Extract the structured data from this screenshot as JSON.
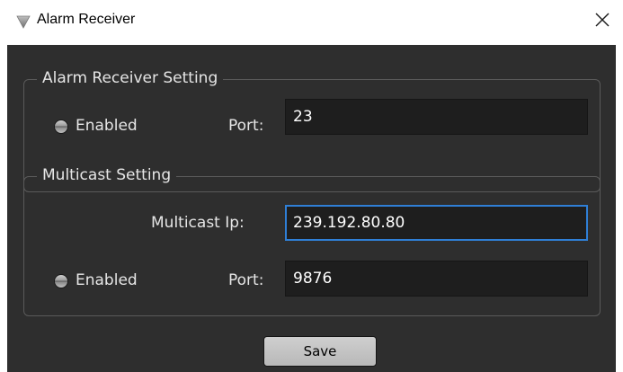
{
  "window": {
    "title": "Alarm Receiver",
    "icon": "triangle-down-icon",
    "close_icon": "close-icon"
  },
  "alarm_receiver": {
    "group_title": "Alarm Receiver Setting",
    "enabled_label": "Enabled",
    "enabled": false,
    "port_label": "Port:",
    "port_value": "23"
  },
  "multicast": {
    "group_title": "Multicast Setting",
    "ip_label": "Multicast Ip:",
    "ip_value": "239.192.80.80",
    "enabled_label": "Enabled",
    "enabled": false,
    "port_label": "Port:",
    "port_value": "9876"
  },
  "actions": {
    "save_label": "Save"
  },
  "colors": {
    "panel_bg": "#2e2e2e",
    "field_bg": "#1e1e1e",
    "focus_border": "#2f7fd6",
    "text": "#e6e6e6"
  }
}
